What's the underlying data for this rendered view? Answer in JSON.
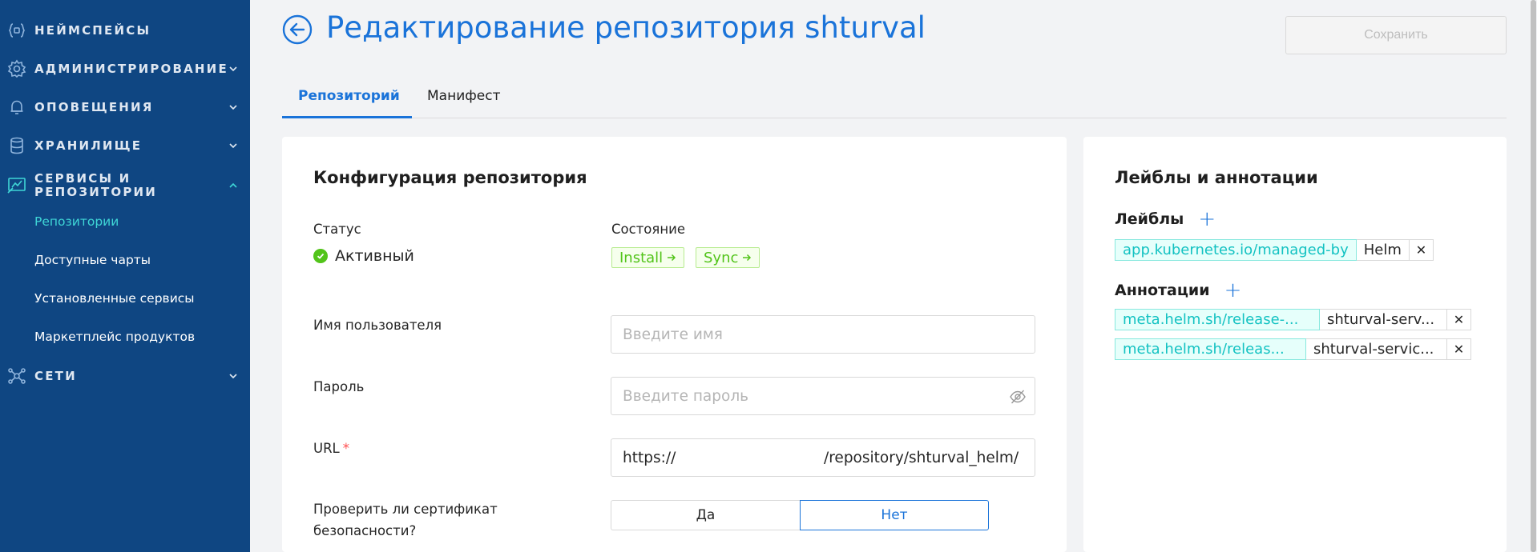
{
  "sidebar": {
    "items": [
      {
        "label": "Неймспейсы",
        "icon": "namespace-icon"
      },
      {
        "label": "Администрирование",
        "icon": "gear-icon"
      },
      {
        "label": "Оповещения",
        "icon": "bell-icon"
      },
      {
        "label": "Хранилище",
        "icon": "database-icon"
      },
      {
        "label": "Сервисы и репозитории",
        "icon": "services-icon"
      },
      {
        "label": "Сети",
        "icon": "network-icon"
      }
    ],
    "subitems": [
      {
        "label": "Репозитории",
        "active": true
      },
      {
        "label": "Доступные чарты"
      },
      {
        "label": "Установленные сервисы"
      },
      {
        "label": "Маркетплейс продуктов"
      }
    ]
  },
  "header": {
    "title": "Редактирование репозитория shturval",
    "save_label": "Сохранить"
  },
  "tabs": [
    {
      "label": "Репозиторий",
      "active": true
    },
    {
      "label": "Манифест"
    }
  ],
  "config": {
    "title": "Конфигурация репозитория",
    "status_label": "Статус",
    "status_value": "Активный",
    "state_label": "Состояние",
    "state_tags": [
      "Install",
      "Sync"
    ],
    "username_label": "Имя пользователя",
    "username_placeholder": "Введите имя",
    "password_label": "Пароль",
    "password_placeholder": "Введите пароль",
    "url_label": "URL",
    "url_required_mark": "*",
    "url_value_start": "https://",
    "url_value_end": "/repository/shturval_helm/",
    "tls_label_line1": "Проверить ли сертификат",
    "tls_label_line2": "безопасности?",
    "tls_yes": "Да",
    "tls_no": "Нет",
    "tls_selected": "Нет"
  },
  "meta": {
    "title": "Лейблы и аннотации",
    "labels_title": "Лейблы",
    "labels": [
      {
        "key": "app.kubernetes.io/managed-by",
        "value": "Helm"
      }
    ],
    "annotations_title": "Аннотации",
    "annotations": [
      {
        "key": "meta.helm.sh/release-...",
        "value": "shturval-serv..."
      },
      {
        "key": "meta.helm.sh/releas...",
        "value": "shturval-servic..."
      }
    ]
  },
  "colors": {
    "sidebar_bg": "#0f4682",
    "accent": "#1a73d9",
    "active_sub": "#3fd6d6",
    "success": "#52c41a"
  }
}
